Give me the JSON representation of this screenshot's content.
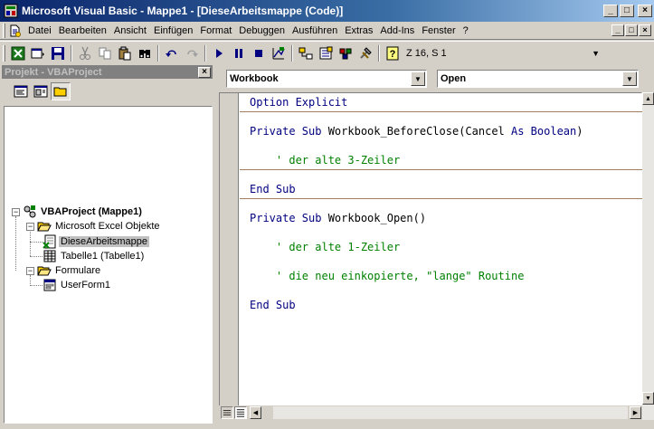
{
  "window": {
    "title": "Microsoft Visual Basic - Mappe1 - [DieseArbeitsmappe (Code)]",
    "controls": {
      "minimize": "_",
      "maximize": "□",
      "close": "×"
    }
  },
  "menu": {
    "items": [
      "Datei",
      "Bearbeiten",
      "Ansicht",
      "Einfügen",
      "Format",
      "Debuggen",
      "Ausführen",
      "Extras",
      "Add-Ins",
      "Fenster",
      "?"
    ]
  },
  "toolbar": {
    "position": "Z 16, S 1"
  },
  "project": {
    "title": "Projekt - VBAProject",
    "close": "×",
    "tree": {
      "root": "VBAProject (Mappe1)",
      "folder1": "Microsoft Excel Objekte",
      "item1": "DieseArbeitsmappe",
      "item2": "Tabelle1 (Tabelle1)",
      "folder2": "Formulare",
      "item3": "UserForm1"
    }
  },
  "code": {
    "object_combo": "Workbook",
    "procedure_combo": "Open",
    "lines": {
      "l1": "Option Explicit",
      "l2a": "Private Sub ",
      "l2b": "Workbook_BeforeClose(Cancel ",
      "l2c": "As Boolean",
      "l2d": ")",
      "l3": "    ' der alte 3-Zeiler",
      "l4": "End Sub",
      "l5a": "Private Sub ",
      "l5b": "Workbook_Open()",
      "l6": "    ' der alte 1-Zeiler",
      "l7": "    ' die neu einkopierte, \"lange\" Routine",
      "l8": "End Sub"
    }
  },
  "colors": {
    "keyword": "#000080",
    "comment": "#008000",
    "titlebar": "#0a246a"
  }
}
